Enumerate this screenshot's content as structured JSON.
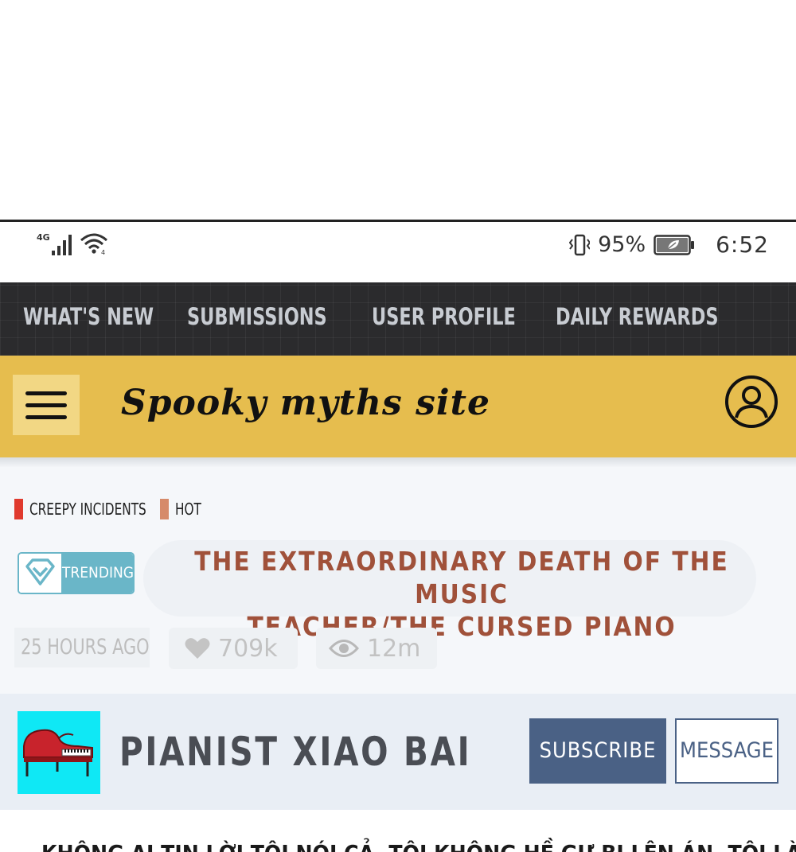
{
  "status_bar": {
    "network": "4G",
    "battery_percent": "95%",
    "time": "6:52"
  },
  "top_nav": {
    "items": [
      {
        "label": "WHAT'S NEW"
      },
      {
        "label": "SUBMISSIONS"
      },
      {
        "label": "USER PROFILE"
      },
      {
        "label": "DAILY REWARDS"
      }
    ]
  },
  "header": {
    "site_title": "Spooky myths site",
    "menu_icon": "hamburger-menu-icon",
    "profile_icon": "user-profile-icon",
    "accent_color": "#e6bd4e"
  },
  "article": {
    "tags": [
      {
        "label": "CREEPY INCIDENTS",
        "color": "#e03a2e"
      },
      {
        "label": "HOT",
        "color": "#d68a6a"
      }
    ],
    "badge_label": "TRENDING",
    "badge_icon": "diamond-heart-icon",
    "title_line1": "THE EXTRAORDINARY DEATH OF THE MUSIC",
    "title_line2": "TEACHER/THE CURSED PIANO",
    "posted": "25 HOURS AGO",
    "likes": "709k",
    "views": "12m"
  },
  "author": {
    "name": "PIANIST XIAO BAI",
    "avatar_icon": "grand-piano-icon",
    "subscribe_label": "SUBSCRIBE",
    "message_label": "MESSAGE"
  },
  "body": {
    "first_line": "KHÔNG AI TIN LỜI TÔI NÓI CẢ, TÔI KHÔNG HỀ GƯ BỊ LÊN ÁN, TÔI LÀ TIỂU BẠCH. HỌC"
  }
}
